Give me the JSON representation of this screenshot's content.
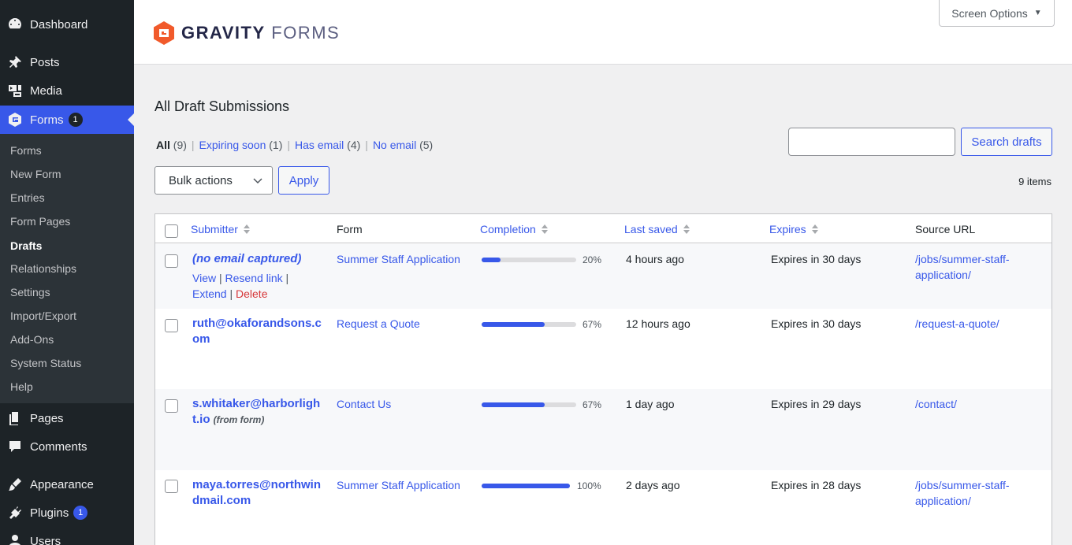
{
  "sidebar": {
    "menu": [
      {
        "label": "Dashboard",
        "icon": "dashboard-icon"
      },
      {
        "label": "Posts",
        "icon": "pin-icon"
      },
      {
        "label": "Media",
        "icon": "media-icon"
      },
      {
        "label": "Forms",
        "icon": "gravity-forms-icon",
        "badge": "1"
      },
      {
        "label": "Pages",
        "icon": "pages-icon"
      },
      {
        "label": "Comments",
        "icon": "comment-icon"
      },
      {
        "label": "Appearance",
        "icon": "brush-icon"
      },
      {
        "label": "Plugins",
        "icon": "plugin-icon",
        "badge": "1"
      },
      {
        "label": "Users",
        "icon": "user-icon"
      }
    ],
    "submenu": [
      "Forms",
      "New Form",
      "Entries",
      "Form Pages",
      "Drafts",
      "Relationships",
      "Settings",
      "Import/Export",
      "Add-Ons",
      "System Status",
      "Help"
    ],
    "active_submenu": "Drafts"
  },
  "header": {
    "logo_bold": "GRAVITY",
    "logo_light": "FORMS",
    "screen_options": "Screen Options"
  },
  "page": {
    "title": "All Draft Submissions",
    "views": [
      {
        "label": "All",
        "count": "(9)"
      },
      {
        "label": "Expiring soon",
        "count": "(1)"
      },
      {
        "label": "Has email",
        "count": "(4)"
      },
      {
        "label": "No email",
        "count": "(5)"
      }
    ],
    "search_button": "Search drafts",
    "search_placeholder": "",
    "bulk_actions": "Bulk actions",
    "apply": "Apply",
    "items_count": "9 items"
  },
  "table": {
    "columns": {
      "submitter": "Submitter",
      "form": "Form",
      "completion": "Completion",
      "last_saved": "Last saved",
      "expires": "Expires",
      "source_url": "Source URL"
    },
    "row_actions": {
      "view": "View",
      "resend": "Resend link",
      "extend": "Extend",
      "delete": "Delete"
    },
    "rows": [
      {
        "submitter": "(no email captured)",
        "note": "",
        "form": "Summer Staff Application",
        "completion": 20,
        "completion_label": "20%",
        "last_saved": "4 hours ago",
        "expires": "Expires in 30 days",
        "url": "/jobs/summer-staff-application/"
      },
      {
        "submitter": "ruth@okaforandsons.com",
        "note": "",
        "form": "Request a Quote",
        "completion": 67,
        "completion_label": "67%",
        "last_saved": "12 hours ago",
        "expires": "Expires in 30 days",
        "url": "/request-a-quote/"
      },
      {
        "submitter": "s.whitaker@harborlight.io",
        "note": "(from form)",
        "form": "Contact Us",
        "completion": 67,
        "completion_label": "67%",
        "last_saved": "1 day ago",
        "expires": "Expires in 29 days",
        "url": "/contact/"
      },
      {
        "submitter": "maya.torres@northwindmail.com",
        "note": "",
        "form": "Summer Staff Application",
        "completion": 100,
        "completion_label": "100%",
        "last_saved": "2 days ago",
        "expires": "Expires in 28 days",
        "url": "/jobs/summer-staff-application/"
      }
    ]
  }
}
